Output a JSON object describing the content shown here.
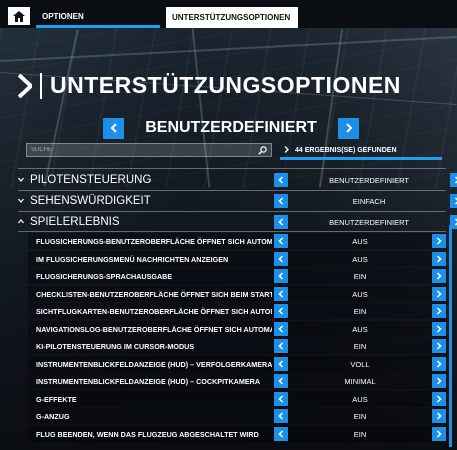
{
  "nav": {
    "home_icon": "home-icon",
    "tabs": [
      {
        "label": "OPTIONEN"
      },
      {
        "label": "UNTERSTÜTZUNGSOPTIONEN"
      }
    ]
  },
  "page": {
    "title": "UNTERSTÜTZUNGSOPTIONEN"
  },
  "preset": {
    "label": "BENUTZERDEFINIERT"
  },
  "search": {
    "placeholder": "SUCHE",
    "value": ""
  },
  "results": {
    "text": "44 ERGEBNIS(SE) GEFUNDEN"
  },
  "categories": [
    {
      "name": "PILOTENSTEUERUNG",
      "value": "BENUTZERDEFINIERT",
      "expanded": false
    },
    {
      "name": "SEHENSWÜRDIGKEIT",
      "value": "EINFACH",
      "expanded": false
    },
    {
      "name": "SPIELERLEBNIS",
      "value": "BENUTZERDEFINIERT",
      "expanded": true
    }
  ],
  "options": [
    {
      "name": "FLUGSICHERUNGS-BENUTZEROBERFLÄCHE ÖFFNET SICH AUTOMATISCH",
      "value": "AUS"
    },
    {
      "name": "IM FLUGSICHERUNGSMENÜ NACHRICHTEN ANZEIGEN",
      "value": "AUS"
    },
    {
      "name": "FLUGSICHERUNGS-SPRACHAUSGABE",
      "value": "EIN"
    },
    {
      "name": "CHECKLISTEN-BENUTZEROBERFLÄCHE ÖFFNET SICH BEIM START",
      "value": "AUS"
    },
    {
      "name": "SICHTFLUGKARTEN-BENUTZEROBERFLÄCHE ÖFFNET SICH AUTOMATISCH",
      "value": "EIN"
    },
    {
      "name": "NAVIGATIONSLOG-BENUTZEROBERFLÄCHE ÖFFNET SICH AUTOMATISCH",
      "value": "AUS"
    },
    {
      "name": "KI-PILOTENSTEUERUNG IM CURSOR-MODUS",
      "value": "EIN"
    },
    {
      "name": "INSTRUMENTENBLICKFELDANZEIGE (HUD) – VERFOLGERKAMERA",
      "value": "VOLL"
    },
    {
      "name": "INSTRUMENTENBLICKFELDANZEIGE (HUD) – COCKPITKAMERA",
      "value": "MINIMAL"
    },
    {
      "name": "G-EFFEKTE",
      "value": "AUS"
    },
    {
      "name": "G-ANZUG",
      "value": "EIN"
    },
    {
      "name": "FLUG BEENDEN, WENN DAS FLUGZEUG ABGESCHALTET WIRD",
      "value": "EIN"
    }
  ],
  "colors": {
    "accent": "#1c8fe8",
    "tab_underline": "#1ea0f0",
    "background": "#0a0d12"
  }
}
